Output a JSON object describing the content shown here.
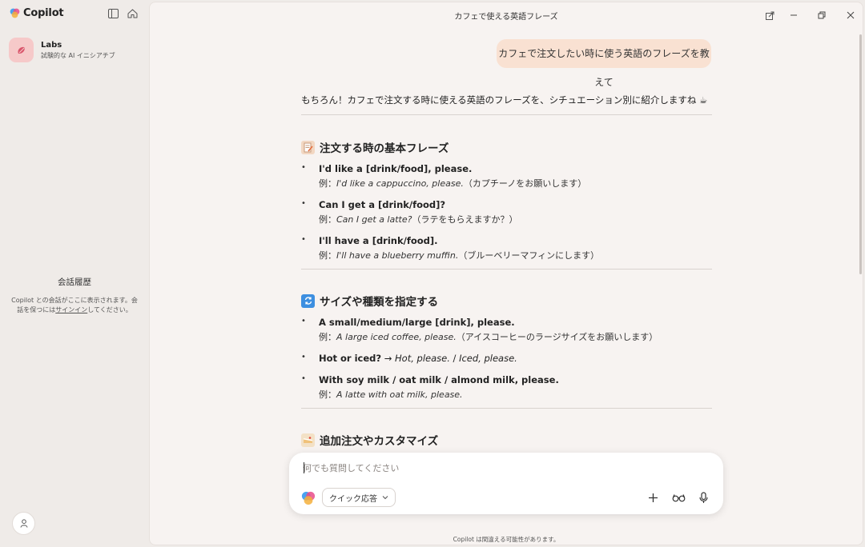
{
  "sidebar": {
    "brand": "Copilot",
    "labs_title": "Labs",
    "labs_subtitle": "試験的な AI イニシアチブ",
    "history_title": "会話履歴",
    "history_desc_1": "Copilot との会話がここに表示されます。会話を保つには",
    "history_link": "サインイン",
    "history_desc_2": "してください。"
  },
  "window": {
    "title": "カフェで使える英語フレーズ"
  },
  "chat": {
    "user_message": "カフェで注文したい時に使う英語のフレーズを教えて",
    "intro": "もちろん！カフェで注文する時に使える英語のフレーズを、シチュエーション別に紹介しますね ☕",
    "sections": [
      {
        "title": "注文する時の基本フレーズ",
        "items": [
          {
            "head": "I'd like a [drink/food], please.",
            "ex_prefix": "例：",
            "ex_en": "I'd like a cappuccino, please.",
            "ex_ja": "（カプチーノをお願いします）"
          },
          {
            "head": "Can I get a [drink/food]?",
            "ex_prefix": "例：",
            "ex_en": "Can I get a latte?",
            "ex_ja": "（ラテをもらえますか？）"
          },
          {
            "head": "I'll have a [drink/food].",
            "ex_prefix": "例：",
            "ex_en": "I'll have a blueberry muffin.",
            "ex_ja": "（ブルーベリーマフィンにします）"
          }
        ]
      },
      {
        "title": "サイズや種類を指定する",
        "items": [
          {
            "head": "A small/medium/large [drink], please.",
            "ex_prefix": "例：",
            "ex_en": "A large iced coffee, please.",
            "ex_ja": "（アイスコーヒーのラージサイズをお願いします）"
          },
          {
            "head": "Hot or iced?",
            "arrow": "→",
            "answer_1": "Hot, please.",
            "sep": "/",
            "answer_2": "Iced, please."
          },
          {
            "head": "With soy milk / oat milk / almond milk, please.",
            "ex_prefix": "例：",
            "ex_en": "A latte with oat milk, please."
          }
        ]
      },
      {
        "title": "追加注文やカスタマイズ"
      }
    ]
  },
  "composer": {
    "placeholder": "何でも質問してください",
    "mode_label": "クイック応答"
  },
  "footer": "Copilot は間違える可能性があります。",
  "icons": {
    "sidebar_toggle": "sidebar-toggle-icon",
    "home": "home-icon",
    "user": "user-icon",
    "pin": "pin-icon",
    "minimize": "minimize-icon",
    "restore": "restore-icon",
    "close": "close-icon",
    "plus": "plus-icon",
    "glasses": "glasses-icon",
    "mic": "mic-icon"
  },
  "colors": {
    "user_bubble": "#f9e1d2",
    "labs_icon_bg": "#f6c9c9",
    "sidebar_bg": "#efebe8",
    "main_bg": "#f7f3f1"
  }
}
